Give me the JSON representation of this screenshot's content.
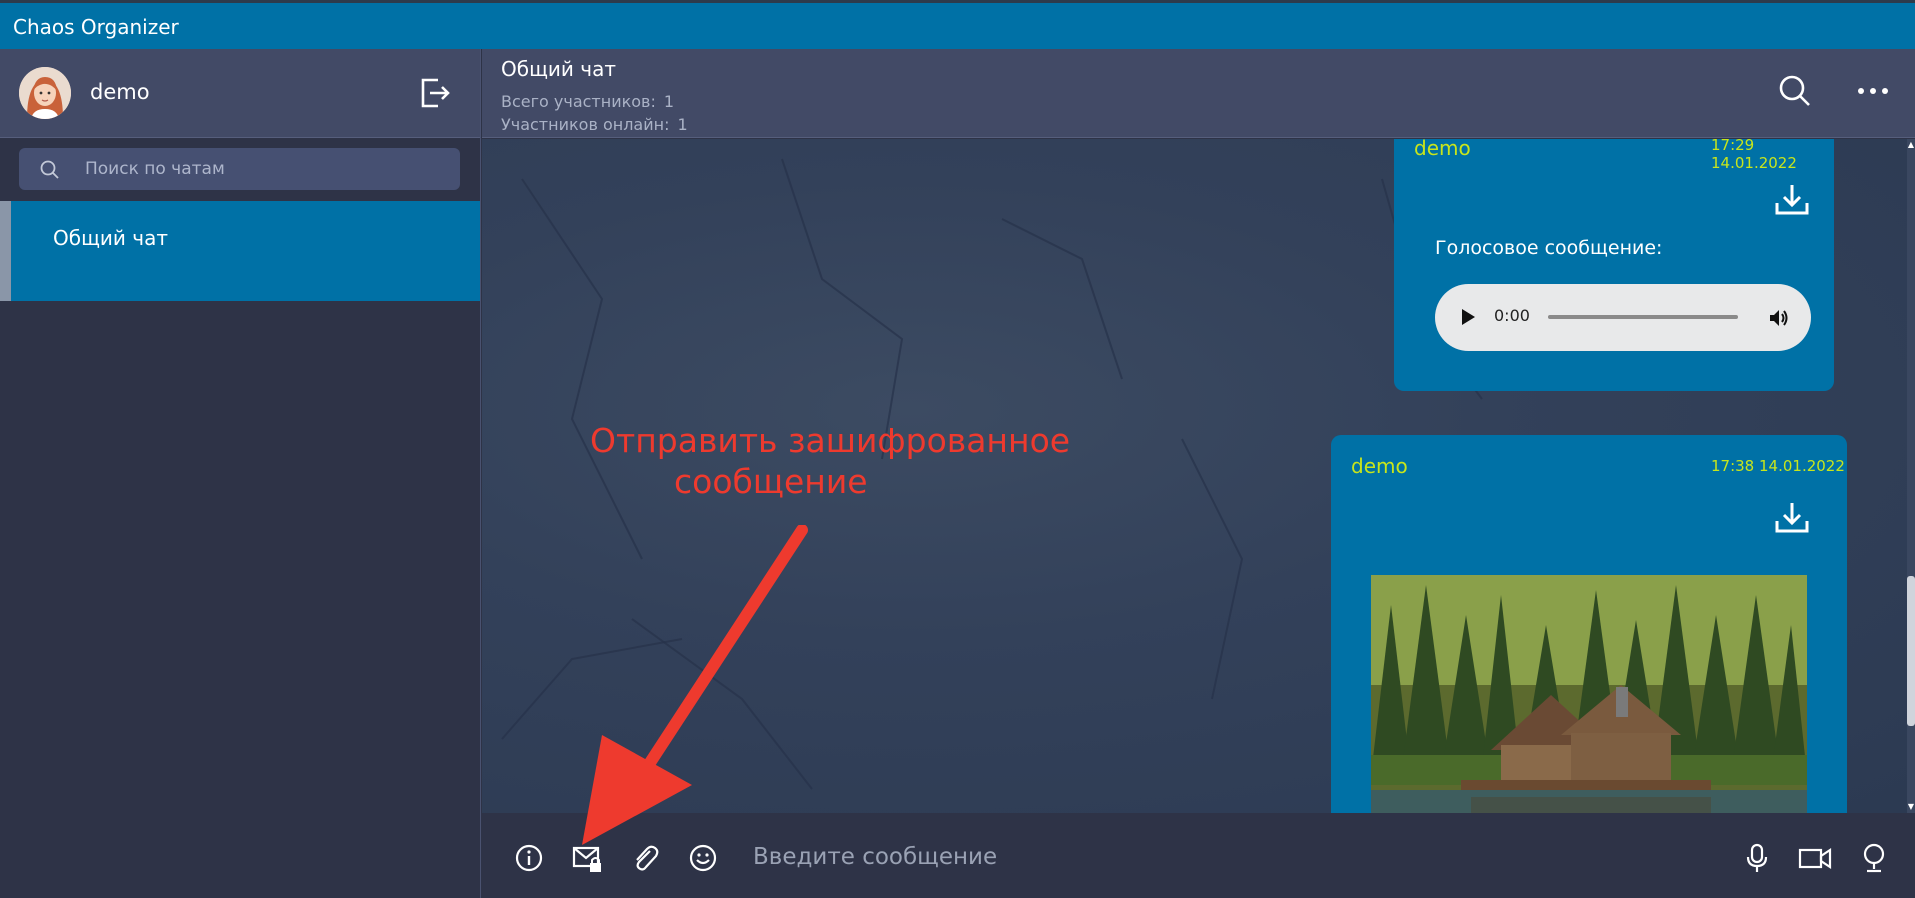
{
  "app": {
    "title": "Chaos Organizer"
  },
  "sidebar": {
    "user": {
      "name": "demo"
    },
    "search": {
      "placeholder": "Поиск по чатам"
    },
    "chats": [
      {
        "label": "Общий чат",
        "active": true
      }
    ]
  },
  "header": {
    "title": "Общий чат",
    "members_label": "Всего участников:",
    "members_count": "1",
    "online_label": "Участников онлайн:",
    "online_count": "1"
  },
  "messages": [
    {
      "author": "demo",
      "time": "17:29 14.01.2022",
      "type": "voice",
      "voice_label": "Голосовое сообщение:",
      "audio_time": "0:00"
    },
    {
      "author": "demo",
      "time": "17:38 14.01.2022",
      "type": "image"
    }
  ],
  "annotation": {
    "line1": "Отправить зашифрованное",
    "line2": "сообщение"
  },
  "composer": {
    "placeholder": "Введите сообщение"
  },
  "colors": {
    "accent": "#0071a6",
    "panel": "#424a66",
    "background": "#2e3347",
    "author": "#c7e51c",
    "annotation": "#ee3a2e"
  }
}
